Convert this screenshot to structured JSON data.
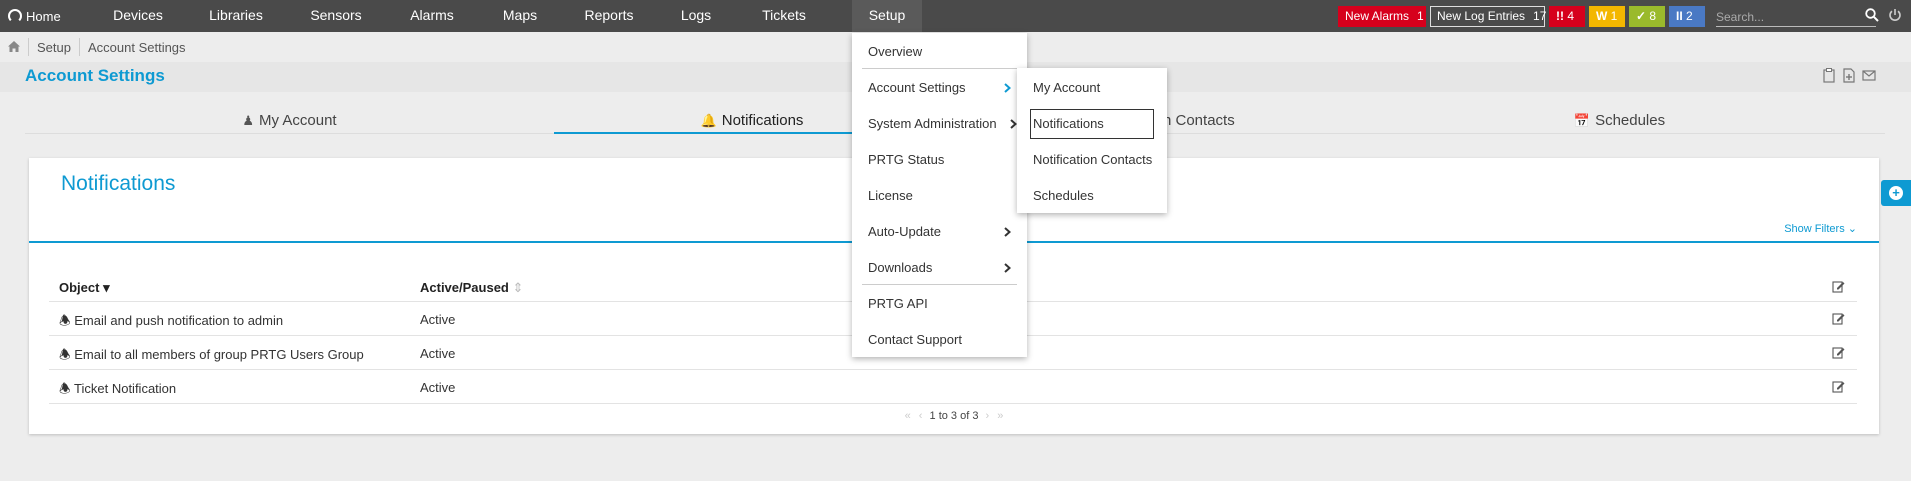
{
  "nav": {
    "home": "Home",
    "items": [
      "Devices",
      "Libraries",
      "Sensors",
      "Alarms",
      "Maps",
      "Reports",
      "Logs",
      "Tickets",
      "Setup"
    ]
  },
  "badges": {
    "new_alarms_label": "New Alarms",
    "new_alarms_count": "1",
    "new_logs_label": "New Log Entries",
    "new_logs_count": "17",
    "red_icon": "!!",
    "red_count": "4",
    "yellow_icon": "W",
    "yellow_count": "1",
    "green_icon": "✓",
    "green_count": "8",
    "blue_icon": "II",
    "blue_count": "2"
  },
  "search": {
    "placeholder": "Search..."
  },
  "breadcrumb": [
    "Setup",
    "Account Settings"
  ],
  "page_title": "Account Settings",
  "tabs": [
    "My Account",
    "Notifications",
    "Notification Contacts",
    "Schedules"
  ],
  "tabs_visible": {
    "contacts_partial": "n Contacts"
  },
  "panel": {
    "title": "Notifications",
    "show_filters": "Show Filters",
    "columns": [
      "Object",
      "Active/Paused"
    ],
    "rows": [
      {
        "object": "Email and push notification to admin",
        "status": "Active"
      },
      {
        "object": "Email to all members of group PRTG Users Group",
        "status": "Active"
      },
      {
        "object": "Ticket Notification",
        "status": "Active"
      }
    ],
    "pager": "1 to 3 of 3"
  },
  "setup_menu": {
    "items": [
      "Overview",
      "Account Settings",
      "System Administration",
      "PRTG Status",
      "License",
      "Auto-Update",
      "Downloads",
      "PRTG API",
      "Contact Support"
    ]
  },
  "account_submenu": {
    "items": [
      "My Account",
      "Notifications",
      "Notification Contacts",
      "Schedules"
    ]
  },
  "colors": {
    "accent": "#0e9ad2",
    "topbar": "#4a4a4a",
    "alarm_red": "#d6001c",
    "warning_yellow": "#f3b700",
    "ok_green": "#9aba2c",
    "paused_blue": "#4a79c4"
  }
}
